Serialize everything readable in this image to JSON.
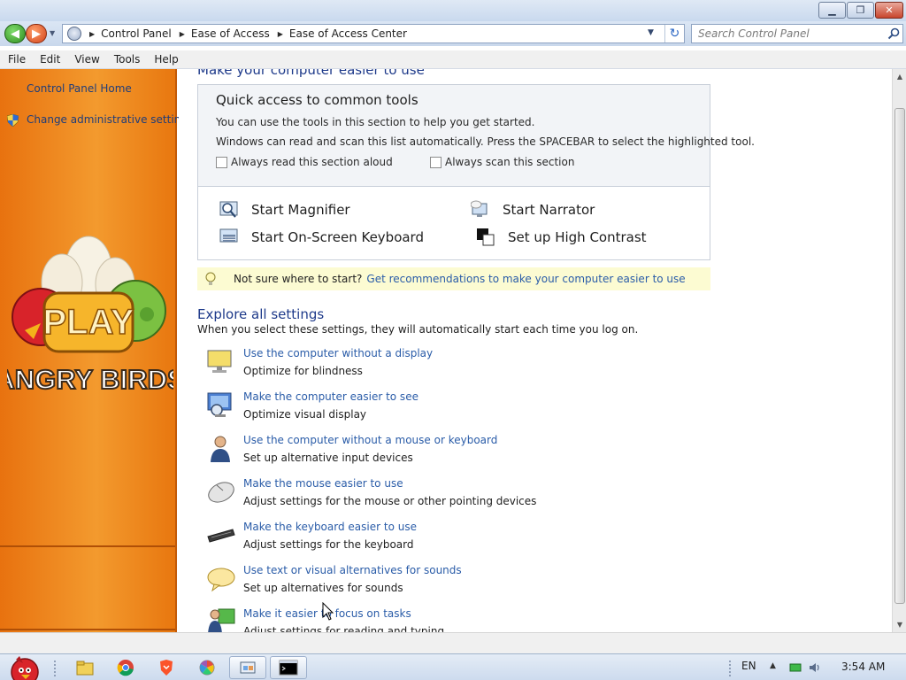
{
  "window": {
    "minimize_glyph": "▁",
    "maximize_glyph": "❐",
    "close_glyph": "✕"
  },
  "nav": {
    "back_glyph": "◀",
    "forward_glyph": "▶",
    "dropdown_glyph": "▼",
    "breadcrumbs": [
      "Control Panel",
      "Ease of Access",
      "Ease of Access Center"
    ],
    "separator_glyph": "▶",
    "refresh_glyph": "↻",
    "search_placeholder": "Search Control Panel",
    "search_value": ""
  },
  "menu": [
    "File",
    "Edit",
    "View",
    "Tools",
    "Help"
  ],
  "sidebar": {
    "links": [
      "Control Panel Home",
      "Change administrative settings"
    ],
    "promo_play_text": "PLAY",
    "promo_brand_text": "ANGRY BIRDS"
  },
  "main": {
    "heading_partial": "Make your computer easier to use",
    "quick": {
      "title": "Quick access to common tools",
      "desc1": "You can use the tools in this section to help you get started.",
      "desc2": "Windows can read and scan this list automatically.  Press the SPACEBAR to select the highlighted tool.",
      "checkbox_read": "Always read this section aloud",
      "checkbox_scan": "Always scan this section",
      "checkbox_read_checked": false,
      "checkbox_scan_checked": false,
      "tools": [
        {
          "label": "Start Magnifier",
          "icon": "magnifier-icon"
        },
        {
          "label": "Start Narrator",
          "icon": "narrator-icon"
        },
        {
          "label": "Start On-Screen Keyboard",
          "icon": "on-screen-keyboard-icon"
        },
        {
          "label": "Set up High Contrast",
          "icon": "high-contrast-icon"
        }
      ]
    },
    "tip": {
      "text": "Not sure where to start?",
      "link": "Get recommendations to make your computer easier to use"
    },
    "explore": {
      "title": "Explore all settings",
      "desc": "When you select these settings, they will automatically start each time you log on.",
      "items": [
        {
          "link": "Use the computer without a display",
          "desc": "Optimize for blindness",
          "icon": "display-icon"
        },
        {
          "link": "Make the computer easier to see",
          "desc": "Optimize visual display",
          "icon": "monitor-icon"
        },
        {
          "link": "Use the computer without a mouse or keyboard",
          "desc": "Set up alternative input devices",
          "icon": "user-icon"
        },
        {
          "link": "Make the mouse easier to use",
          "desc": "Adjust settings for the mouse or other pointing devices",
          "icon": "mouse-icon"
        },
        {
          "link": "Make the keyboard easier to use",
          "desc": "Adjust settings for the keyboard",
          "icon": "keyboard-icon"
        },
        {
          "link": "Use text or visual alternatives for sounds",
          "desc": "Set up alternatives for sounds",
          "icon": "speech-bubble-icon"
        },
        {
          "link": "Make it easier to focus on tasks",
          "desc": "Adjust settings for reading and typing",
          "icon": "focus-tasks-icon"
        }
      ]
    }
  },
  "scrollbar": {
    "up_glyph": "▲",
    "down_glyph": "▼"
  },
  "taskbar": {
    "apps": [
      "windows-explorer",
      "chrome",
      "brave",
      "picasa",
      "control-panel",
      "command-prompt"
    ],
    "language": "EN",
    "tray_up_glyph": "▲",
    "clock": "3:54 AM"
  },
  "colors": {
    "sidebar_orange": "#f0861f",
    "link_blue": "#2a5ca8",
    "heading_blue": "#1e3a8a",
    "tip_yellow": "#fcfbd2"
  }
}
